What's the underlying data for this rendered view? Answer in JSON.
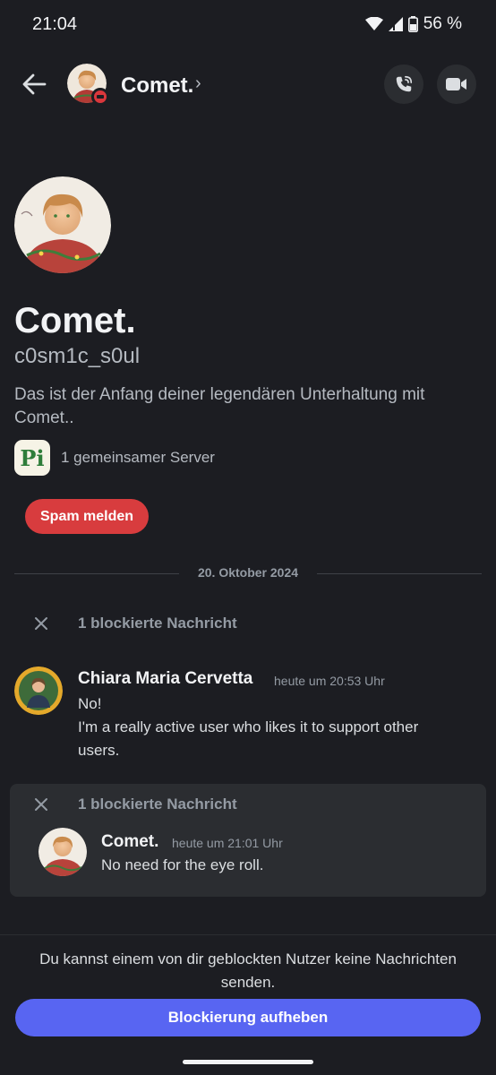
{
  "status_bar": {
    "time": "21:04",
    "battery": "56 %",
    "icons": [
      "wifi-icon",
      "signal-icon",
      "battery-icon"
    ]
  },
  "header": {
    "name": "Comet.",
    "chevron": "›",
    "icons": [
      "back-arrow-icon",
      "phone-call-icon",
      "video-camera-icon"
    ],
    "status": "do-not-disturb"
  },
  "profile": {
    "display_name": "Comet.",
    "username": "c0sm1c_s0ul",
    "intro": "Das ist der Anfang deiner legendären Unterhaltung mit Comet..",
    "mutual_server_icon": "Pi",
    "mutual_servers": "1 gemeinsamer Server",
    "spam_button": "Spam melden"
  },
  "date_divider": "20. Oktober 2024",
  "blocked_1": {
    "label": "1 blockierte Nachricht"
  },
  "message_1": {
    "author": "Chiara Maria Cervetta",
    "time": "heute um 20:53 Uhr",
    "line1": "No!",
    "line2": "I'm a really active user who likes it to support other users."
  },
  "blocked_2": {
    "label": "1 blockierte Nachricht",
    "author": "Comet.",
    "time": "heute um 21:01 Uhr",
    "text": "No need for the eye roll."
  },
  "footer": {
    "notice": "Du kannst einem von dir geblockten Nutzer keine Nachrichten senden.",
    "unblock_button": "Blockierung aufheben"
  },
  "colors": {
    "accent": "#5865f2",
    "danger": "#d83c3e",
    "background": "#1c1d22",
    "card": "#2b2d31"
  }
}
